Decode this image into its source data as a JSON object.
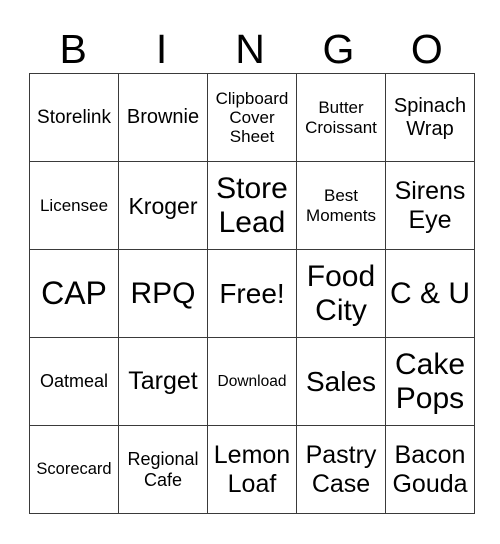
{
  "header": {
    "letters": [
      "B",
      "I",
      "N",
      "G",
      "O"
    ]
  },
  "grid": {
    "rows": [
      [
        "Storelink",
        "Brownie",
        "Clipboard Cover Sheet",
        "Butter Croissant",
        "Spinach Wrap"
      ],
      [
        "Licensee",
        "Kroger",
        "Store Lead",
        "Best Moments",
        "Sirens Eye"
      ],
      [
        "CAP",
        "RPQ",
        "Free!",
        "Food City",
        "C & U"
      ],
      [
        "Oatmeal",
        "Target",
        "Download",
        "Sales",
        "Cake Pops"
      ],
      [
        "Scorecard",
        "Regional Cafe",
        "Lemon Loaf",
        "Pastry Case",
        "Bacon Gouda"
      ]
    ]
  }
}
